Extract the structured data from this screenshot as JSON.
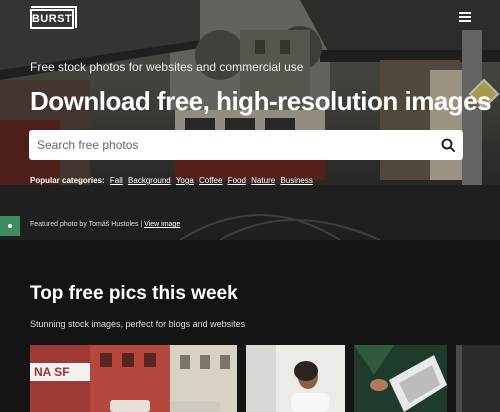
{
  "header": {
    "logo_text": "BURST",
    "menu_icon": "hamburger-menu-icon"
  },
  "hero": {
    "tagline": "Free stock photos for websites and commercial use",
    "headline": "Download free, high-resolution images",
    "search": {
      "placeholder": "Search free photos",
      "value": "",
      "icon": "search-icon"
    },
    "categories_label": "Popular categories:",
    "categories": [
      "Fall",
      "Background",
      "Yoga",
      "Coffee",
      "Food",
      "Nature",
      "Business"
    ],
    "credit_text": "Featured photo by Tomáš Hustoles |",
    "credit_link": "View image"
  },
  "section": {
    "title": "Top free pics this week",
    "subtitle": "Stunning stock images, perfect for blogs and websites",
    "store_sign": "NA SF"
  },
  "colors": {
    "accent_green": "#3d8c62",
    "background": "#141414"
  }
}
